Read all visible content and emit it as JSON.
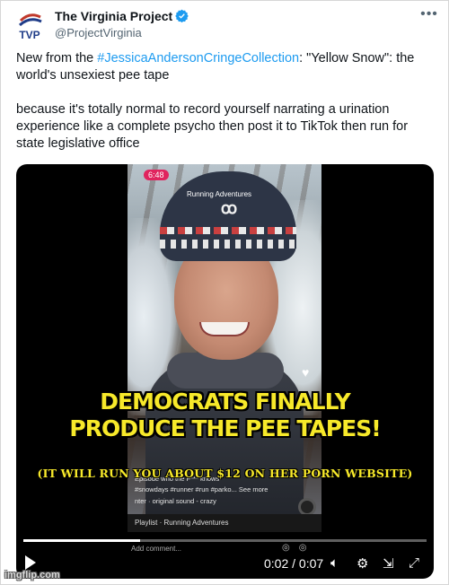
{
  "account": {
    "name": "The Virginia Project",
    "handle": "@ProjectVirginia",
    "avatar_text": "TVP"
  },
  "menu_icon": "more-horizontal-icon",
  "tweet": {
    "line1_prefix": "New from the ",
    "hashtag": "#JessicaAndersonCringeCollection",
    "line1_suffix": ": \"Yellow Snow\": the world's unsexiest pee tape",
    "paragraph2": "because it's totally normal to record yourself narrating a urination experience like a complete psycho then post it to TikTok then run for state legislative office"
  },
  "video": {
    "time_badge": "6:48",
    "title": "Running Adventures",
    "caption1": "Episode who the F*** knows",
    "caption2": "#snowdays #runner #run #parko... See more",
    "caption3": "nter · original sound - crazy",
    "playlist": "Playlist · Running Adventures",
    "comment_placeholder": "Add comment...",
    "progress": 0.29,
    "timecode": "0:02 / 0:07"
  },
  "meme": {
    "line1": "DEMOCRATS FINALLY",
    "line2": "PRODUCE THE PEE TAPES!",
    "subtext": "(IT WILL RUN YOU ABOUT $12 ON HER PORN WEBSITE)"
  },
  "controls": {
    "play": "play-icon",
    "volume": "volume-icon",
    "settings": "gear-icon",
    "captions": "captions-icon",
    "fullscreen": "fullscreen-icon"
  },
  "watermark": "imgflip.com",
  "colors": {
    "link": "#1d9bf0",
    "meme_text": "#f7e92a",
    "verified": "#1d9bf0"
  }
}
